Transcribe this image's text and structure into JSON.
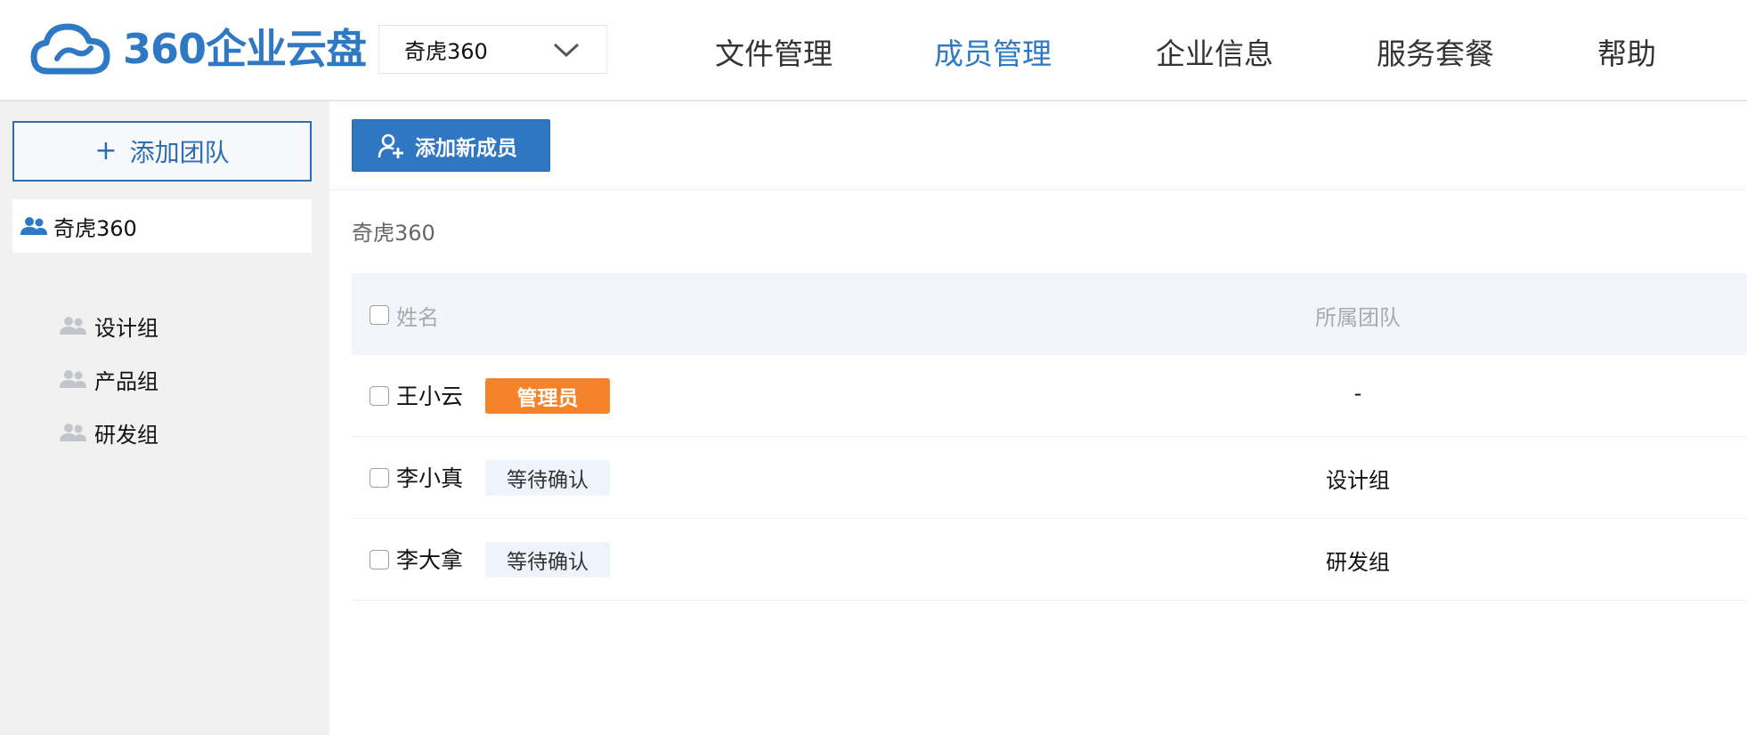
{
  "header": {
    "logo_text": "360企业云盘",
    "org_select": {
      "value": "奇虎360"
    },
    "nav": [
      {
        "label": "文件管理",
        "active": false
      },
      {
        "label": "成员管理",
        "active": true
      },
      {
        "label": "企业信息",
        "active": false
      },
      {
        "label": "服务套餐",
        "active": false
      },
      {
        "label": "帮助",
        "active": false
      }
    ]
  },
  "sidebar": {
    "add_team_label": "添加团队",
    "root_team": "奇虎360",
    "sub_teams": [
      "设计组",
      "产品组",
      "研发组"
    ]
  },
  "main": {
    "add_member_label": "添加新成员",
    "breadcrumb": "奇虎360",
    "table": {
      "headers": {
        "name": "姓名",
        "team": "所属团队"
      },
      "rows": [
        {
          "name": "王小云",
          "badge": "管理员",
          "badge_type": "admin",
          "team": "-"
        },
        {
          "name": "李小真",
          "badge": "等待确认",
          "badge_type": "pending",
          "team": "设计组"
        },
        {
          "name": "李大拿",
          "badge": "等待确认",
          "badge_type": "pending",
          "team": "研发组"
        }
      ]
    }
  },
  "colors": {
    "brand_blue": "#2f78c4",
    "admin_orange": "#f6822a",
    "sidebar_bg": "#f1f1f1",
    "table_header_bg": "#f2f6fc"
  }
}
